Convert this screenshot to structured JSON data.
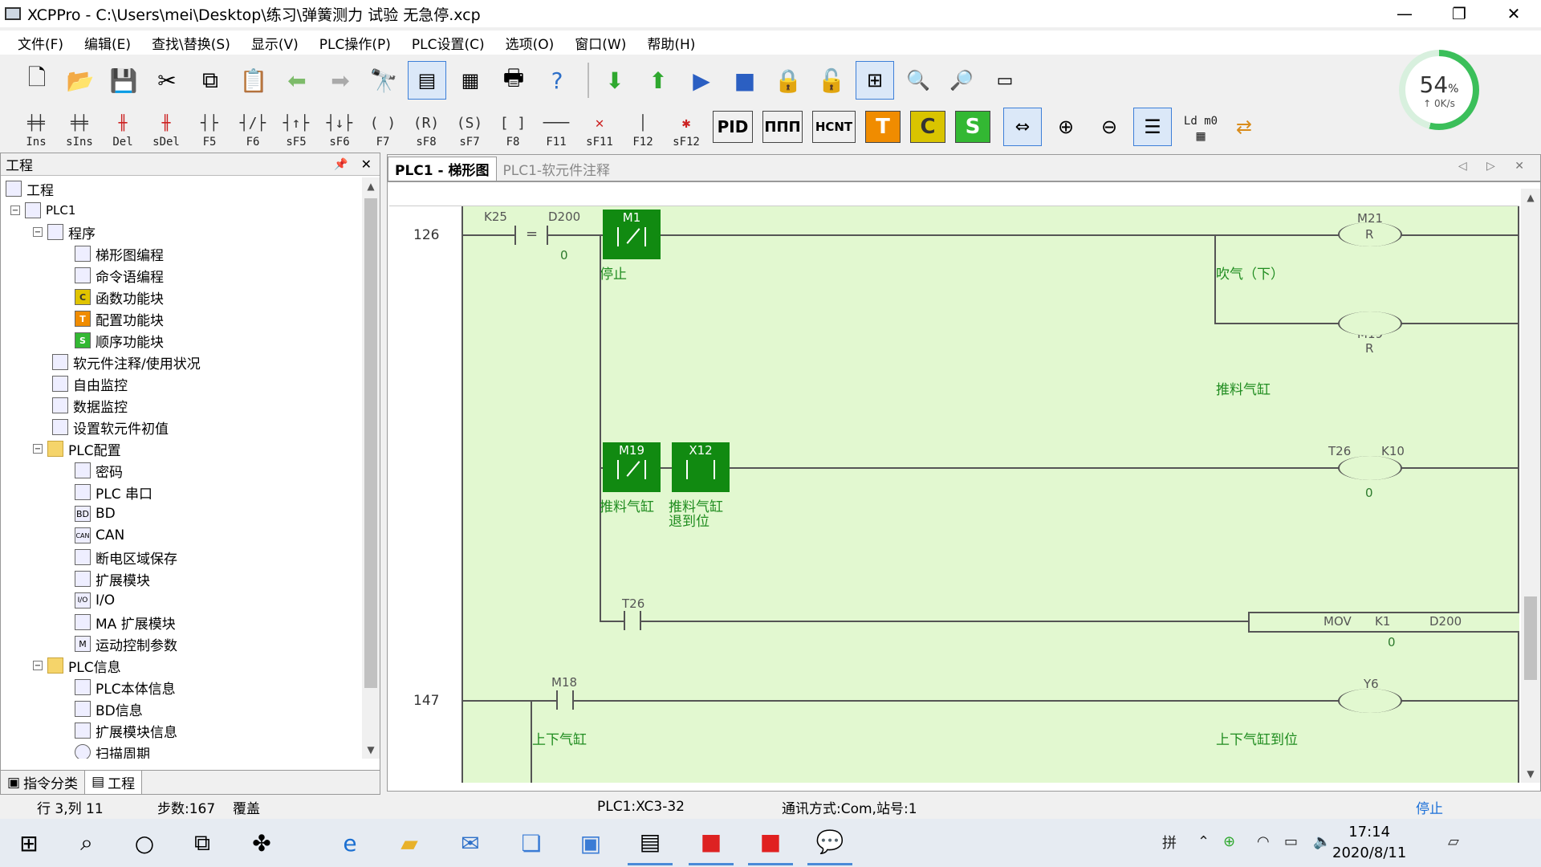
{
  "window": {
    "title": "XCPPro - C:\\Users\\mei\\Desktop\\练习\\弹簧测力 试验 无急停.xcp",
    "minimize": "—",
    "restore": "❐",
    "close": "✕"
  },
  "menu": [
    "文件(F)",
    "编辑(E)",
    "查找\\替换(S)",
    "显示(V)",
    "PLC操作(P)",
    "PLC设置(C)",
    "选项(O)",
    "窗口(W)",
    "帮助(H)"
  ],
  "ladder_toolbar": {
    "keys": [
      "Ins",
      "sIns",
      "Del",
      "sDel",
      "F5",
      "F6",
      "sF5",
      "sF6",
      "F7",
      "sF8",
      "sF7",
      "F8",
      "F11",
      "sF11",
      "F12",
      "sF12"
    ],
    "symbols": [
      "╪╪",
      "╪╪",
      "╫",
      "╫",
      "┤├",
      "┤/├",
      "┤↑├",
      "┤↓├",
      "( )",
      "(R)",
      "(S)",
      "[ ]",
      "───",
      "✕",
      "│",
      "✱"
    ],
    "pid": "PID",
    "pulse": "ΠΠΠ",
    "hcnt": "HCNT",
    "t_block": "T",
    "c_block": "C",
    "s_block": "S",
    "ldm0": "Ld m0"
  },
  "gauge": {
    "percent": "54",
    "unit": "%",
    "rate": "↑ 0K/s",
    "fraction": 0.54
  },
  "project_panel": {
    "title": "工程",
    "pin": "📌",
    "close": "✕",
    "tree": [
      {
        "label": "工程",
        "icon": "project-icon"
      },
      {
        "label": "PLC1",
        "icon": "plc-icon"
      },
      {
        "label": "程序",
        "icon": "program-icon"
      },
      {
        "label": "梯形图编程",
        "icon": "ladder-icon"
      },
      {
        "label": "命令语编程",
        "icon": "instruction-icon"
      },
      {
        "label": "函数功能块",
        "icon": "function-block-icon"
      },
      {
        "label": "配置功能块",
        "icon": "config-block-icon"
      },
      {
        "label": "顺序功能块",
        "icon": "sequence-block-icon"
      },
      {
        "label": "软元件注释/使用状况",
        "icon": "comment-icon"
      },
      {
        "label": "自由监控",
        "icon": "monitor-icon"
      },
      {
        "label": "数据监控",
        "icon": "data-monitor-icon"
      },
      {
        "label": "设置软元件初值",
        "icon": "init-value-icon"
      },
      {
        "label": "PLC配置",
        "icon": "folder-icon"
      },
      {
        "label": "密码",
        "icon": "password-icon"
      },
      {
        "label": "PLC 串口",
        "icon": "serial-port-icon"
      },
      {
        "label": "BD",
        "icon": "bd-icon"
      },
      {
        "label": "CAN",
        "icon": "can-icon"
      },
      {
        "label": "断电区域保存",
        "icon": "power-save-icon"
      },
      {
        "label": "扩展模块",
        "icon": "expansion-icon"
      },
      {
        "label": "I/O",
        "icon": "io-icon"
      },
      {
        "label": "MA 扩展模块",
        "icon": "ma-expansion-icon"
      },
      {
        "label": "运动控制参数",
        "icon": "motion-icon"
      },
      {
        "label": "PLC信息",
        "icon": "folder-icon"
      },
      {
        "label": "PLC本体信息",
        "icon": "info-icon"
      },
      {
        "label": "BD信息",
        "icon": "bd-info-icon"
      },
      {
        "label": "扩展模块信息",
        "icon": "expansion-info-icon"
      },
      {
        "label": "扫描周期",
        "icon": "scan-cycle-icon"
      }
    ],
    "icon_text": {
      "ic_C": "C",
      "ic_T": "T",
      "ic_S": "S",
      "ic_BD": "BD",
      "ic_CAN": "CAN",
      "ic_IO": "I/O",
      "ic_M": "M"
    },
    "tabs": [
      "指令分类",
      "工程"
    ]
  },
  "editor": {
    "tabs": [
      "PLC1 - 梯形图",
      "PLC1-软元件注释"
    ],
    "nav": "◁ ▷ ✕",
    "rungs": {
      "r126": "126",
      "r147": "147"
    },
    "ladder": {
      "k25": "K25",
      "d200": "D200",
      "eq": "=",
      "d200_val": "0",
      "m1": "M1",
      "m1_cmt": "停止",
      "m21": "M21",
      "m21_type": "R",
      "m21_cmt": "吹气（下）",
      "m19_coil": "M19",
      "m19_coil_type": "R",
      "m19_coil_cmt": "推料气缸",
      "m19": "M19",
      "m19_cmt": "推料气缸",
      "x12": "X12",
      "x12_cmt": "推料气缸",
      "x12_cmt2": "退到位",
      "t26_coil": "T26",
      "k10": "K10",
      "t26_coil_val": "0",
      "t26": "T26",
      "mov": "MOV",
      "mov_k1": "K1",
      "mov_d200": "D200",
      "mov_val": "0",
      "m18": "M18",
      "m18_cmt": "上下气缸",
      "y6": "Y6",
      "y6_cmt": "上下气缸到位"
    }
  },
  "status": {
    "position": "行 3,列 11",
    "steps": "步数:167",
    "mode": "覆盖",
    "plc": "PLC1:XC3-32",
    "comm": "通讯方式:Com,站号:1",
    "run_state": "停止"
  },
  "taskbar": {
    "time": "17:14",
    "date": "2020/8/11",
    "ime": "拼"
  },
  "colors": {
    "ladder_bg": "#e2f8d0",
    "active_contact": "#118a11",
    "comment": "#1f8c1f",
    "stop_status": "#1a6fd8"
  }
}
